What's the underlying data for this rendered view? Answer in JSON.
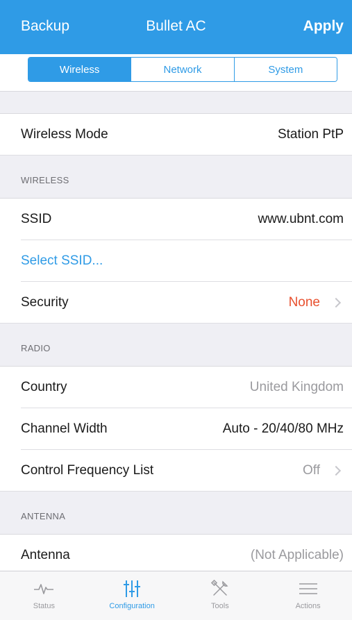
{
  "header": {
    "left_label": "Backup",
    "title": "Bullet AC",
    "right_label": "Apply"
  },
  "tabs": [
    {
      "label": "Wireless",
      "active": true
    },
    {
      "label": "Network",
      "active": false
    },
    {
      "label": "System",
      "active": false
    }
  ],
  "rows": {
    "wireless_mode": {
      "label": "Wireless Mode",
      "value": "Station PtP"
    },
    "ssid": {
      "label": "SSID",
      "value": "www.ubnt.com"
    },
    "select_ssid": {
      "label": "Select SSID..."
    },
    "security": {
      "label": "Security",
      "value": "None"
    },
    "country": {
      "label": "Country",
      "value": "United Kingdom"
    },
    "channel_width": {
      "label": "Channel Width",
      "value": "Auto - 20/40/80 MHz"
    },
    "control_frequency_list": {
      "label": "Control Frequency List",
      "value": "Off"
    },
    "antenna": {
      "label": "Antenna",
      "value": "(Not Applicable)"
    }
  },
  "sections": {
    "wireless": "WIRELESS",
    "radio": "RADIO",
    "antenna": "ANTENNA"
  },
  "tabbar": [
    {
      "label": "Status",
      "icon": "pulse-icon",
      "active": false
    },
    {
      "label": "Configuration",
      "icon": "sliders-icon",
      "active": true
    },
    {
      "label": "Tools",
      "icon": "tools-icon",
      "active": false
    },
    {
      "label": "Actions",
      "icon": "menu-icon",
      "active": false
    }
  ],
  "colors": {
    "accent": "#2f9be6",
    "danger": "#e8502e",
    "muted": "#9a9a9e"
  }
}
